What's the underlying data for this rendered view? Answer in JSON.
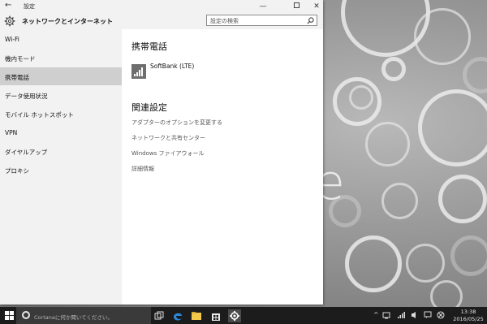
{
  "window": {
    "title": "設定",
    "back_glyph": "←",
    "min_glyph": "—",
    "close_glyph": "✕"
  },
  "header": {
    "title": "ネットワークとインターネット",
    "search_placeholder": "設定の検索"
  },
  "sidebar": {
    "items": [
      {
        "label": "Wi-Fi"
      },
      {
        "label": "機内モード"
      },
      {
        "label": "携帯電話"
      },
      {
        "label": "データ使用状況"
      },
      {
        "label": "モバイル ホットスポット"
      },
      {
        "label": "VPN"
      },
      {
        "label": "ダイヤルアップ"
      },
      {
        "label": "プロキシ"
      }
    ],
    "active_index": 2
  },
  "content": {
    "section_title": "携帯電話",
    "network_name": "SoftBank (LTE)",
    "related_title": "関連設定",
    "links": [
      {
        "label": "アダプターのオプションを変更する"
      },
      {
        "label": "ネットワークと共有センター"
      },
      {
        "label": "Windows ファイアウォール"
      },
      {
        "label": "詳細情報"
      }
    ]
  },
  "taskbar": {
    "cortana_placeholder": "Cortanaに何か聞いてください。",
    "time": "13:38",
    "date": "2016/05/25"
  },
  "desktop": {
    "watermark_letter": "e"
  }
}
